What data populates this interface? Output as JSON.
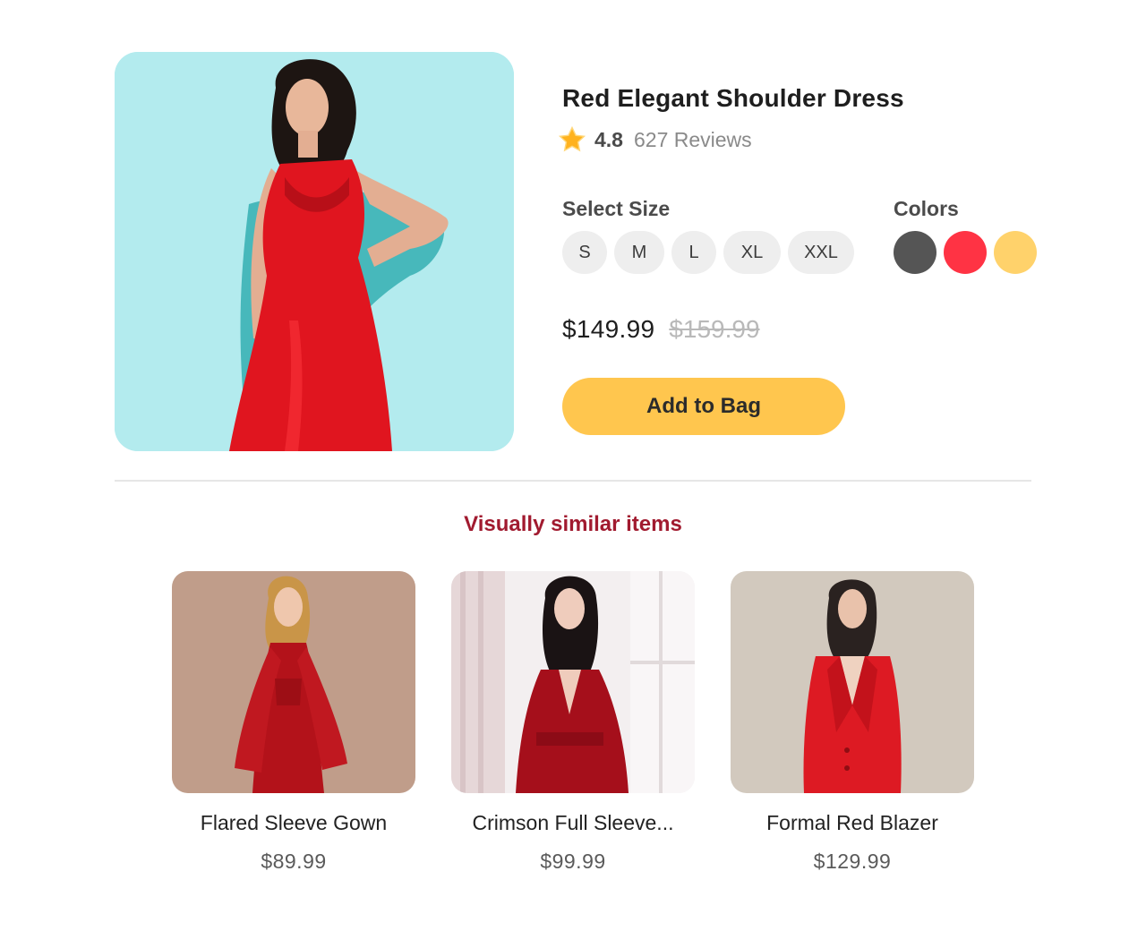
{
  "product": {
    "image_icon": "woman-in-red-slip-dress-photo",
    "title": "Red Elegant Shoulder Dress",
    "rating_icon": "star-icon",
    "rating": "4.8",
    "reviews": "627 Reviews",
    "size_label": "Select Size",
    "sizes": [
      "S",
      "M",
      "L",
      "XL",
      "XXL"
    ],
    "colors_label": "Colors",
    "colors": [
      "#555555",
      "#ff3344",
      "#ffd26b"
    ],
    "price": "$149.99",
    "old_price": "$159.99",
    "add_button": "Add to Bag"
  },
  "similar": {
    "heading": "Visually similar items",
    "items": [
      {
        "name": "Flared Sleeve Gown",
        "price": "$89.99",
        "image_icon": "flared-sleeve-gown-photo"
      },
      {
        "name": "Crimson Full Sleeve...",
        "price": "$99.99",
        "image_icon": "crimson-dress-photo"
      },
      {
        "name": "Formal Red Blazer",
        "price": "$129.99",
        "image_icon": "red-blazer-photo"
      }
    ]
  },
  "colors": {
    "accent": "#ffc64e",
    "heading": "#a11a2f",
    "hero_background": "#b3ebee"
  }
}
